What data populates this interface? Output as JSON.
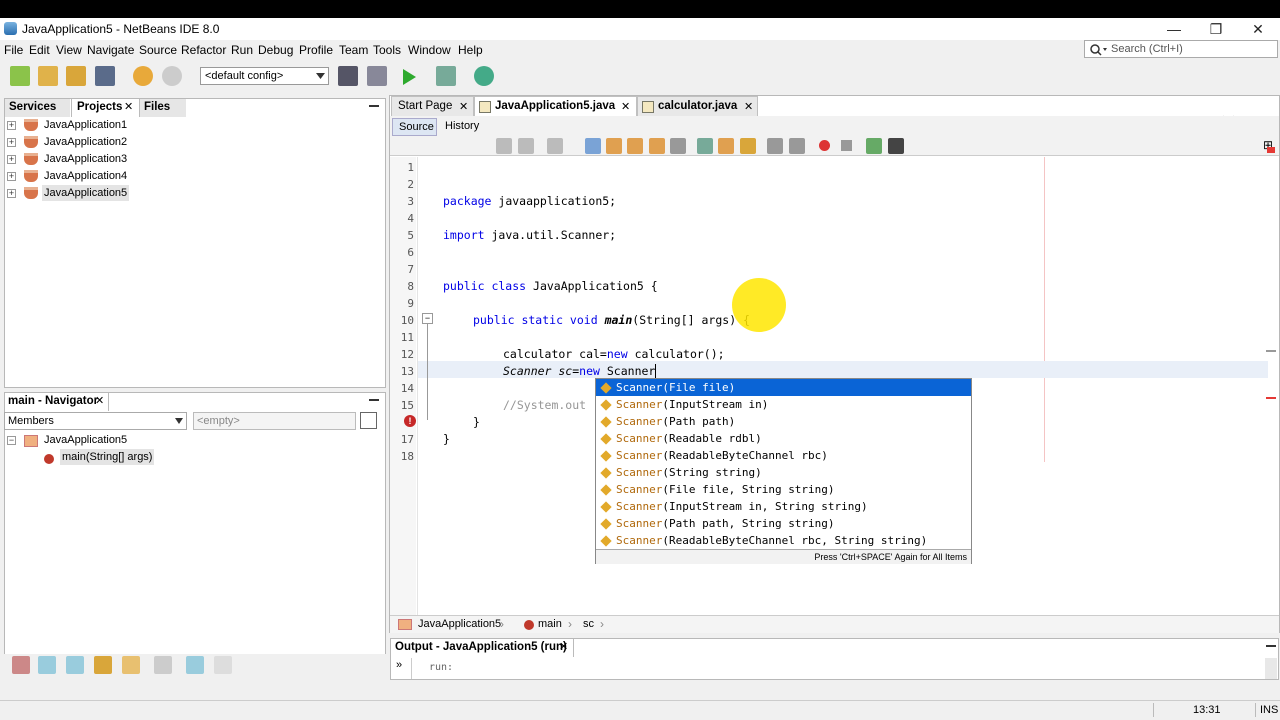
{
  "window": {
    "title": "JavaApplication5 - NetBeans IDE 8.0",
    "minimize": "—",
    "maximize": "❐",
    "close": "✕"
  },
  "menu": [
    "File",
    "Edit",
    "View",
    "Navigate",
    "Source",
    "Refactor",
    "Run",
    "Debug",
    "Profile",
    "Team",
    "Tools",
    "Window",
    "Help"
  ],
  "search": {
    "placeholder": "Search (Ctrl+I)"
  },
  "toolbar": {
    "config": "<default config>"
  },
  "projects_panel": {
    "tabs": [
      "Services",
      "Projects",
      "Files"
    ],
    "items": [
      "JavaApplication1",
      "JavaApplication2",
      "JavaApplication3",
      "JavaApplication4",
      "JavaApplication5"
    ]
  },
  "navigator": {
    "title": "main - Navigator",
    "filter": "Members",
    "empty": "<empty>",
    "root": "JavaApplication5",
    "child": "main(String[] args)"
  },
  "editor": {
    "tabs": [
      "Start Page",
      "JavaApplication5.java",
      "calculator.java"
    ],
    "modes": [
      "Source",
      "History"
    ],
    "line_numbers": [
      "1",
      "2",
      "3",
      "4",
      "5",
      "6",
      "7",
      "8",
      "9",
      "10",
      "11",
      "12",
      "13",
      "14",
      "15",
      "16",
      "17",
      "18"
    ],
    "breadcrumb": [
      "JavaApplication5",
      "main",
      "sc"
    ]
  },
  "code": {
    "l3_kw": "package",
    "l3_rest": " javaapplication5;",
    "l5_kw": "import",
    "l5_rest": " java.util.Scanner;",
    "l8_kw": "public class",
    "l8_rest": " JavaApplication5 {",
    "l10_kw": "public static void",
    "l10_main": "main",
    "l10_rest": "(String[] args) {",
    "l12_a": "calculator cal=",
    "l12_kw": "new",
    "l12_b": " calculator();",
    "l13_a": "Scanner sc=",
    "l13_kw": "new",
    "l13_b": " Scanner",
    "l15": "//System.out",
    "l16": "}",
    "l17": "}"
  },
  "completion": {
    "items": [
      {
        "name": "Scanner",
        "params": "(File file)"
      },
      {
        "name": "Scanner",
        "params": "(InputStream in)"
      },
      {
        "name": "Scanner",
        "params": "(Path path)"
      },
      {
        "name": "Scanner",
        "params": "(Readable rdbl)"
      },
      {
        "name": "Scanner",
        "params": "(ReadableByteChannel rbc)"
      },
      {
        "name": "Scanner",
        "params": "(String string)"
      },
      {
        "name": "Scanner",
        "params": "(File file, String string)"
      },
      {
        "name": "Scanner",
        "params": "(InputStream in, String string)"
      },
      {
        "name": "Scanner",
        "params": "(Path path, String string)"
      },
      {
        "name": "Scanner",
        "params": "(ReadableByteChannel rbc, String string)"
      }
    ],
    "footer": "Press 'Ctrl+SPACE' Again for All Items"
  },
  "output": {
    "title": "Output - JavaApplication5 (run)",
    "text": "run:"
  },
  "status": {
    "position": "13:31",
    "mode": "INS"
  }
}
